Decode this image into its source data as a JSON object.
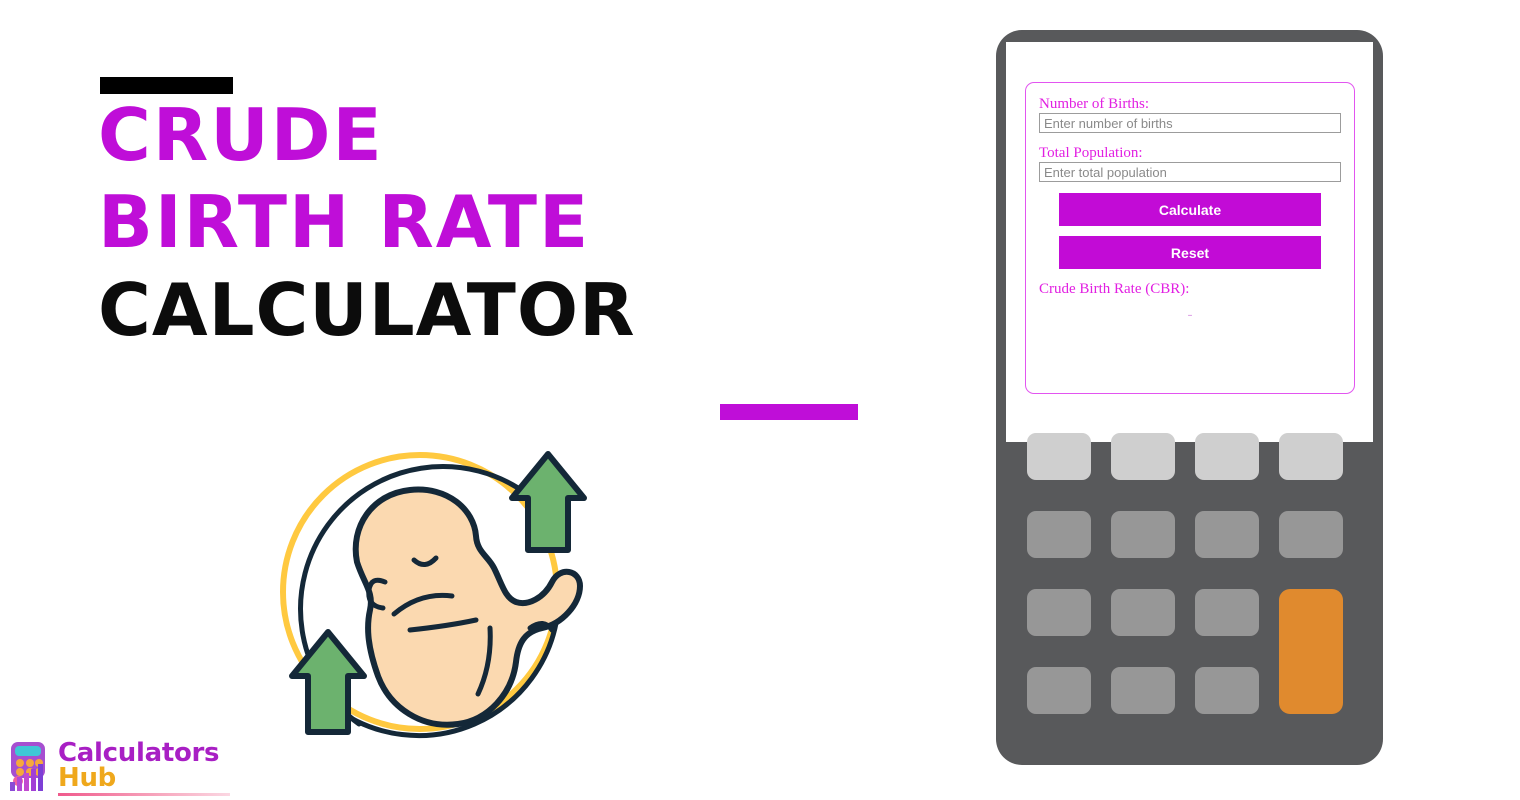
{
  "hero": {
    "title_lines": [
      "CRUDE",
      "BIRTH RATE",
      "CALCULATOR"
    ],
    "accent_bar_color": "#bf0ed8",
    "dark_bar_color": "#000000",
    "title_colors": [
      "#bf0ed8",
      "#bf0ed8",
      "#0c0c0c"
    ]
  },
  "illustration": {
    "name": "baby-in-circle-with-up-arrows",
    "skin_color": "#fbd9b0",
    "outline_color": "#142838",
    "circle_color": "#ffc940",
    "arrow_color": "#6cb26e"
  },
  "logo": {
    "word_one": "Calculators",
    "word_two": "Hub",
    "word_one_color": "#a81fc4",
    "word_two_color": "#efa81c"
  },
  "calculator": {
    "body_color": "#58595b",
    "screen_color": "#ffffff",
    "accent_color": "#c20bd6",
    "form": {
      "fields": [
        {
          "label": "Number of Births:",
          "placeholder": "Enter number of births",
          "value": ""
        },
        {
          "label": "Total Population:",
          "placeholder": "Enter total population",
          "value": ""
        }
      ],
      "calculate_label": "Calculate",
      "reset_label": "Reset",
      "result_label": "Crude Birth Rate (CBR):",
      "result_value": "-"
    },
    "keypad": {
      "rows": [
        [
          "light",
          "light",
          "light",
          "light"
        ],
        [
          "mid",
          "mid",
          "mid",
          "mid"
        ],
        [
          "mid",
          "mid",
          "mid",
          "accent"
        ],
        [
          "mid",
          "mid",
          "mid",
          "accent"
        ]
      ],
      "light_color": "#cfcfcf",
      "mid_color": "#979797",
      "accent_color": "#e08a2e"
    }
  }
}
